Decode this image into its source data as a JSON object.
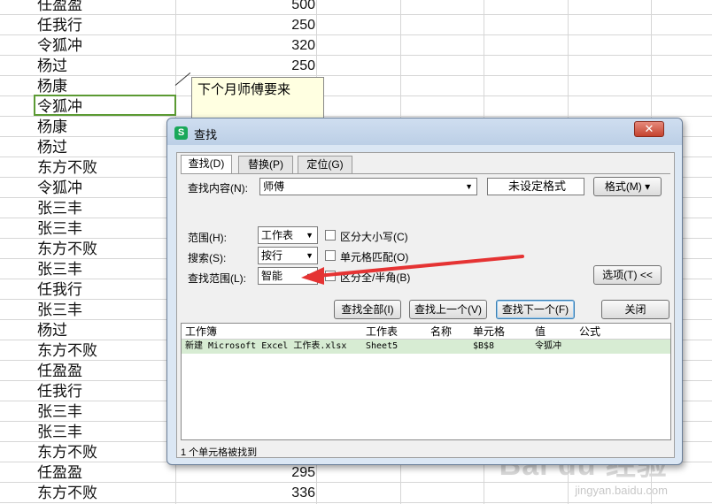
{
  "sheet": {
    "rows": [
      {
        "name": "任盈盈",
        "value": "500"
      },
      {
        "name": "任我行",
        "value": "250"
      },
      {
        "name": "令狐冲",
        "value": "320"
      },
      {
        "name": "杨过",
        "value": "250"
      },
      {
        "name": "杨康",
        "value": ""
      },
      {
        "name": "令狐冲",
        "value": ""
      },
      {
        "name": "杨康",
        "value": ""
      },
      {
        "name": "杨过",
        "value": ""
      },
      {
        "name": "东方不败",
        "value": ""
      },
      {
        "name": "令狐冲",
        "value": ""
      },
      {
        "name": "张三丰",
        "value": ""
      },
      {
        "name": "张三丰",
        "value": ""
      },
      {
        "name": "东方不败",
        "value": ""
      },
      {
        "name": "张三丰",
        "value": ""
      },
      {
        "name": "任我行",
        "value": ""
      },
      {
        "name": "张三丰",
        "value": ""
      },
      {
        "name": "杨过",
        "value": ""
      },
      {
        "name": "东方不败",
        "value": ""
      },
      {
        "name": "任盈盈",
        "value": ""
      },
      {
        "name": "任我行",
        "value": ""
      },
      {
        "name": "张三丰",
        "value": ""
      },
      {
        "name": "张三丰",
        "value": ""
      },
      {
        "name": "东方不败",
        "value": ""
      },
      {
        "name": "任盈盈",
        "value": "295"
      },
      {
        "name": "东方不败",
        "value": "336"
      }
    ],
    "comment": "下个月师傅要来"
  },
  "dialog": {
    "title": "查找",
    "app_icon": "S",
    "close": "✕",
    "tabs": {
      "find": "查找(D)",
      "replace": "替换(P)",
      "goto": "定位(G)"
    },
    "find_label": "查找内容(N):",
    "find_value": "师傅",
    "format_status": "未设定格式",
    "format_button": "格式(M)",
    "scope_label": "范围(H):",
    "scope_value": "工作表",
    "search_label": "搜索(S):",
    "search_value": "按行",
    "lookin_label": "查找范围(L):",
    "lookin_value": "智能",
    "match_case": "区分大小写(C)",
    "match_cell": "单元格匹配(O)",
    "match_width": "区分全/半角(B)",
    "options_button": "选项(T) <<",
    "find_all": "查找全部(I)",
    "find_prev": "查找上一个(V)",
    "find_next": "查找下一个(F)",
    "close_button": "关闭",
    "results": {
      "headers": {
        "book": "工作簿",
        "sheet": "工作表",
        "name": "名称",
        "cell": "单元格",
        "value": "值",
        "formula": "公式"
      },
      "row": {
        "book": "新建 Microsoft Excel 工作表.xlsx",
        "sheet": "Sheet5",
        "name": "",
        "cell": "$B$8",
        "value": "令狐冲",
        "formula": ""
      }
    },
    "status": "1 个单元格被找到"
  },
  "watermark": {
    "brand": "Bai du 经验",
    "url": "jingyan.baidu.com"
  },
  "colors": {
    "selection": "#5b9a33",
    "arrow": "#e53333",
    "result_highlight": "#d7ecd3"
  }
}
